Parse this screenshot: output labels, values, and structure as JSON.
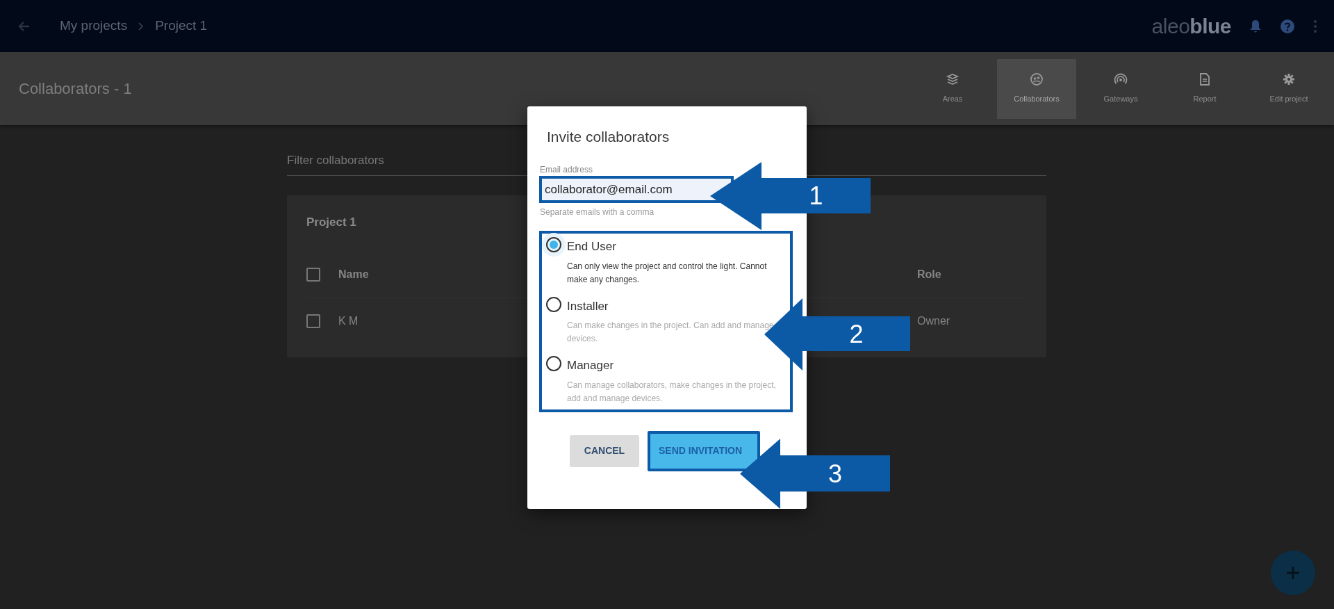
{
  "top_bar": {
    "breadcrumbs": [
      "My projects",
      "Project 1"
    ],
    "logo": {
      "light": "aleo",
      "bold": "blue"
    }
  },
  "page_header": {
    "title": "Collaborators - 1",
    "tabs": [
      {
        "label": "Areas",
        "selected": false,
        "kind": "areas"
      },
      {
        "label": "Collaborators",
        "selected": true,
        "kind": "collaborators"
      },
      {
        "label": "Gateways",
        "selected": false,
        "kind": "gateways"
      },
      {
        "label": "Report",
        "selected": false,
        "kind": "report"
      },
      {
        "label": "Edit project",
        "selected": false,
        "kind": "settings"
      }
    ]
  },
  "filter": {
    "placeholder": "Filter collaborators"
  },
  "table": {
    "title": "Project 1",
    "all_checked": false,
    "columns": [
      "Name",
      "Role"
    ],
    "rows": [
      {
        "name": "K M",
        "role": "Owner",
        "checked": false
      }
    ]
  },
  "dialog": {
    "title": "Invite collaborators",
    "email": {
      "label": "Email address",
      "value": "collaborator@email.com",
      "hint": "Separate emails with a comma"
    },
    "roles": [
      {
        "label": "End User",
        "description": "Can only view the project and control the light. Cannot make any changes.",
        "selected": true
      },
      {
        "label": "Installer",
        "description": "Can make changes in the project. Can add and manage devices.",
        "selected": false
      },
      {
        "label": "Manager",
        "description": "Can manage collaborators, make changes in the project, add and manage devices.",
        "selected": false
      }
    ],
    "cancel": "CANCEL",
    "send": "SEND INVITATION"
  },
  "annotations": [
    {
      "number": "1"
    },
    {
      "number": "2"
    },
    {
      "number": "3"
    }
  ]
}
